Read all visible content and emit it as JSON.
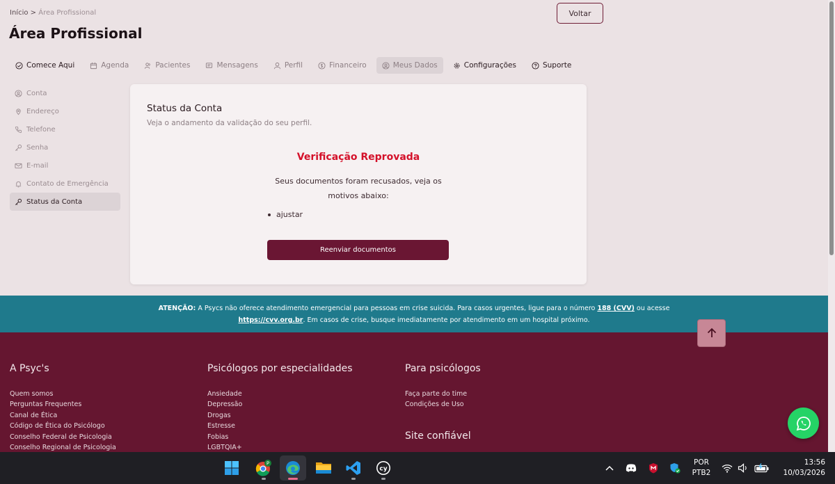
{
  "breadcrumb": {
    "home": "Início",
    "separator": ">",
    "current": "Área Profissional"
  },
  "page_title": "Área Profissional",
  "back_button": "Voltar",
  "tabs": [
    {
      "label": "Comece Aqui",
      "icon": "check-circle-icon"
    },
    {
      "label": "Agenda",
      "icon": "calendar-icon"
    },
    {
      "label": "Pacientes",
      "icon": "users-icon"
    },
    {
      "label": "Mensagens",
      "icon": "message-icon"
    },
    {
      "label": "Perfil",
      "icon": "user-icon"
    },
    {
      "label": "Financeiro",
      "icon": "dollar-icon"
    },
    {
      "label": "Meus Dados",
      "icon": "user-circle-icon"
    },
    {
      "label": "Configurações",
      "icon": "gear-icon"
    },
    {
      "label": "Suporte",
      "icon": "help-icon"
    }
  ],
  "active_tab": "Meus Dados",
  "sidebar": [
    {
      "label": "Conta",
      "icon": "user-circle-icon"
    },
    {
      "label": "Endereço",
      "icon": "map-pin-icon"
    },
    {
      "label": "Telefone",
      "icon": "phone-icon"
    },
    {
      "label": "Senha",
      "icon": "key-icon"
    },
    {
      "label": "E-mail",
      "icon": "mail-icon"
    },
    {
      "label": "Contato de Emergência",
      "icon": "alert-icon"
    },
    {
      "label": "Status da Conta",
      "icon": "key-icon"
    }
  ],
  "active_sidebar": "Status da Conta",
  "card": {
    "title": "Status da Conta",
    "subtitle": "Veja o andamento da validação do seu perfil.",
    "status_heading": "Verificação Reprovada",
    "status_message": "Seus documentos foram recusados, veja os motivos abaixo:",
    "reasons": [
      "ajustar"
    ],
    "resend_button": "Reenviar documentos"
  },
  "alert": {
    "label": "ATENÇÃO:",
    "text_1": "A Psycs não oferece atendimento emergencial para pessoas em crise suicida. Para casos urgentes, ligue para o número",
    "phone": "188 (CVV)",
    "text_2": "ou acesse",
    "link": "https://cvv.org.br",
    "text_3": ". Em casos de crise, busque imediatamente por atendimento em um hospital próximo."
  },
  "footer": {
    "col1": {
      "title": "A Psyc's",
      "links": [
        "Quem somos",
        "Perguntas Frequentes",
        "Canal de Ética",
        "Código de Ética do Psicólogo",
        "Conselho Federal de Psicologia",
        "Conselho Regional de Psicologia"
      ]
    },
    "col2": {
      "title": "Psicólogos por especialidades",
      "links": [
        "Ansiedade",
        "Depressão",
        "Drogas",
        "Estresse",
        "Fobias",
        "LGBTQIA+"
      ]
    },
    "col3": {
      "title": "Para psicólogos",
      "links": [
        "Faça parte do time",
        "Condições de Uso"
      ]
    },
    "trust_title": "Site confiável"
  },
  "taskbar": {
    "apps": [
      "windows-start-icon",
      "chrome-icon",
      "edge-icon",
      "file-explorer-icon",
      "vscode-icon",
      "cypress-icon"
    ],
    "language": "POR",
    "keyboard": "PTB2",
    "time": "13:56",
    "date": "10/03/2026"
  },
  "colors": {
    "brand": "#6a1633",
    "footer": "#651630",
    "alert_bar": "#1f7a8c",
    "status_error": "#d4112a",
    "whatsapp": "#25d366"
  }
}
